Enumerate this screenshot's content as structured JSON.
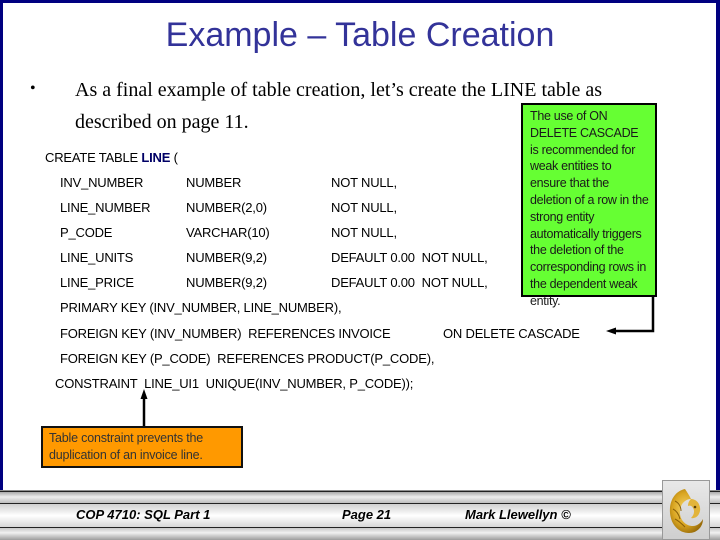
{
  "slide": {
    "title": "Example – Table Creation",
    "bullet_symbol": "•",
    "intro_text": "As a final example of table creation, let’s create the LINE table as described on page 11."
  },
  "sql": {
    "create_prefix": "CREATE TABLE ",
    "table_name": "LINE",
    "create_suffix": " (",
    "columns": [
      {
        "name": "INV_NUMBER",
        "type": "NUMBER",
        "constraint": "NOT NULL,"
      },
      {
        "name": "LINE_NUMBER",
        "type": "NUMBER(2,0)",
        "constraint": "NOT NULL,"
      },
      {
        "name": "P_CODE",
        "type": "VARCHAR(10)",
        "constraint": "NOT NULL,"
      },
      {
        "name": "LINE_UNITS",
        "type": "NUMBER(9,2)",
        "constraint": "DEFAULT 0.00  NOT NULL,"
      },
      {
        "name": "LINE_PRICE",
        "type": "NUMBER(9,2)",
        "constraint": "DEFAULT 0.00  NOT NULL,"
      }
    ],
    "primary_key": "PRIMARY KEY (INV_NUMBER, LINE_NUMBER),",
    "foreign_key_1": "FOREIGN KEY (INV_NUMBER)  REFERENCES INVOICE",
    "on_delete": "ON DELETE CASCADE",
    "foreign_key_2": "FOREIGN KEY (P_CODE)  REFERENCES PRODUCT(P_CODE),",
    "constraint": "CONSTRAINT  LINE_UI1  UNIQUE(INV_NUMBER, P_CODE));"
  },
  "notes": {
    "green": "The use of ON DELETE CASCADE is recommended for weak entities to ensure that the deletion of a row in the strong entity automatically triggers the deletion of the corresponding rows in the dependent weak entity.",
    "orange": "Table constraint prevents the duplication of an invoice line."
  },
  "footer": {
    "course": "COP 4710: SQL Part 1",
    "page": "Page 21",
    "author": "Mark Llewellyn ©",
    "logo_icon": "ucf-pegasus-logo"
  },
  "colors": {
    "frame": "#000080",
    "title": "#333399",
    "green_note": "#66FF33",
    "orange_note": "#FF9900"
  }
}
